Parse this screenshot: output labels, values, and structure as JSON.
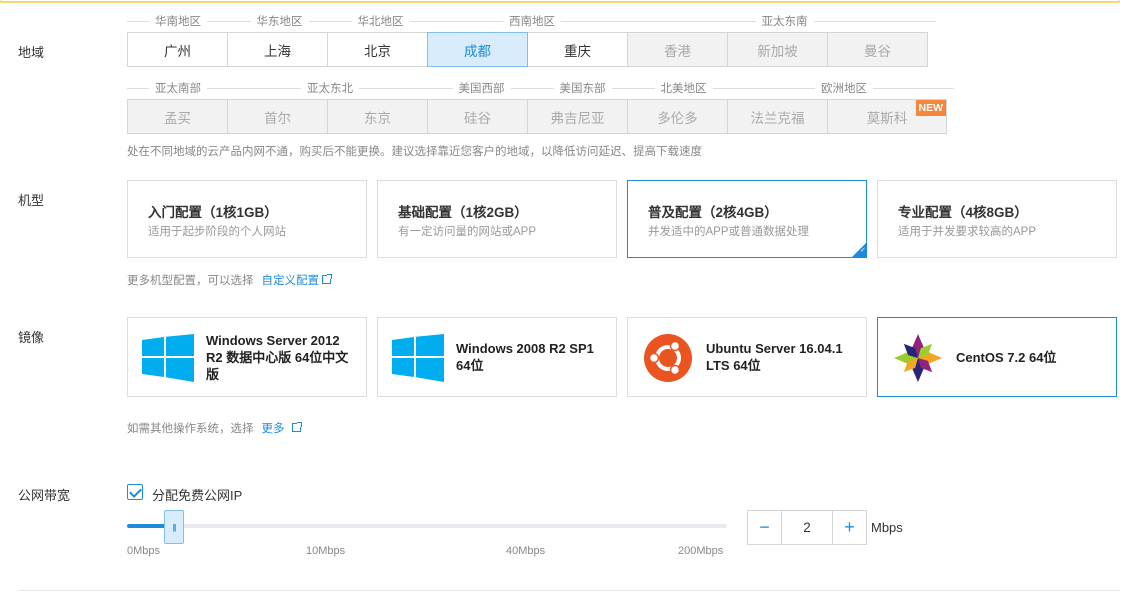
{
  "labels": {
    "region": "地域",
    "instance": "机型",
    "image": "镜像",
    "bandwidth": "公网带宽"
  },
  "region_groups_row1": [
    "华南地区",
    "华东地区",
    "华北地区",
    "西南地区",
    "亚太东南"
  ],
  "region_groups_row2": [
    "亚太南部",
    "亚太东北",
    "美国西部",
    "美国东部",
    "北美地区",
    "欧洲地区"
  ],
  "regions_row1": [
    {
      "label": "广州",
      "state": "normal"
    },
    {
      "label": "上海",
      "state": "normal"
    },
    {
      "label": "北京",
      "state": "normal"
    },
    {
      "label": "成都",
      "state": "selected"
    },
    {
      "label": "重庆",
      "state": "normal"
    },
    {
      "label": "香港",
      "state": "disabled"
    },
    {
      "label": "新加坡",
      "state": "disabled"
    },
    {
      "label": "曼谷",
      "state": "disabled"
    }
  ],
  "regions_row2": [
    {
      "label": "孟买",
      "state": "disabled"
    },
    {
      "label": "首尔",
      "state": "disabled"
    },
    {
      "label": "东京",
      "state": "disabled"
    },
    {
      "label": "硅谷",
      "state": "disabled"
    },
    {
      "label": "弗吉尼亚",
      "state": "disabled"
    },
    {
      "label": "多伦多",
      "state": "disabled"
    },
    {
      "label": "法兰克福",
      "state": "disabled"
    },
    {
      "label": "莫斯科",
      "state": "disabled"
    }
  ],
  "new_badge": "NEW",
  "region_hint": "处在不同地域的云产品内网不通，购买后不能更换。建议选择靠近您客户的地域，以降低访问延迟、提高下载速度",
  "configs": [
    {
      "title": "入门配置（1核1GB）",
      "desc": "适用于起步阶段的个人网站"
    },
    {
      "title": "基础配置（1核2GB）",
      "desc": "有一定访问量的网站或APP"
    },
    {
      "title": "普及配置（2核4GB）",
      "desc": "并发适中的APP或普通数据处理"
    },
    {
      "title": "专业配置（4核8GB）",
      "desc": "适用于并发要求较高的APP"
    }
  ],
  "config_hint": "更多机型配置，可以选择",
  "config_link": "自定义配置",
  "images": [
    {
      "name": "Windows Server 2012 R2 数据中心版 64位中文版",
      "icon": "windows-icon"
    },
    {
      "name": "Windows 2008 R2 SP1 64位",
      "icon": "windows-icon"
    },
    {
      "name": "Ubuntu Server 16.04.1 LTS 64位",
      "icon": "ubuntu-icon"
    },
    {
      "name": "CentOS 7.2 64位",
      "icon": "centos-icon"
    }
  ],
  "image_hint": "如需其他操作系统，选择",
  "image_link": "更多",
  "bandwidth": {
    "checkbox_label": "分配免费公网IP",
    "checked": true,
    "value": "2",
    "unit": "Mbps",
    "ticks": [
      "0Mbps",
      "10Mbps",
      "40Mbps",
      "200Mbps"
    ],
    "decrement": "−",
    "increment": "+"
  },
  "colors": {
    "accent": "#1e8bd8",
    "selected_bg": "#d8ecfb",
    "badge": "#f5863c"
  }
}
